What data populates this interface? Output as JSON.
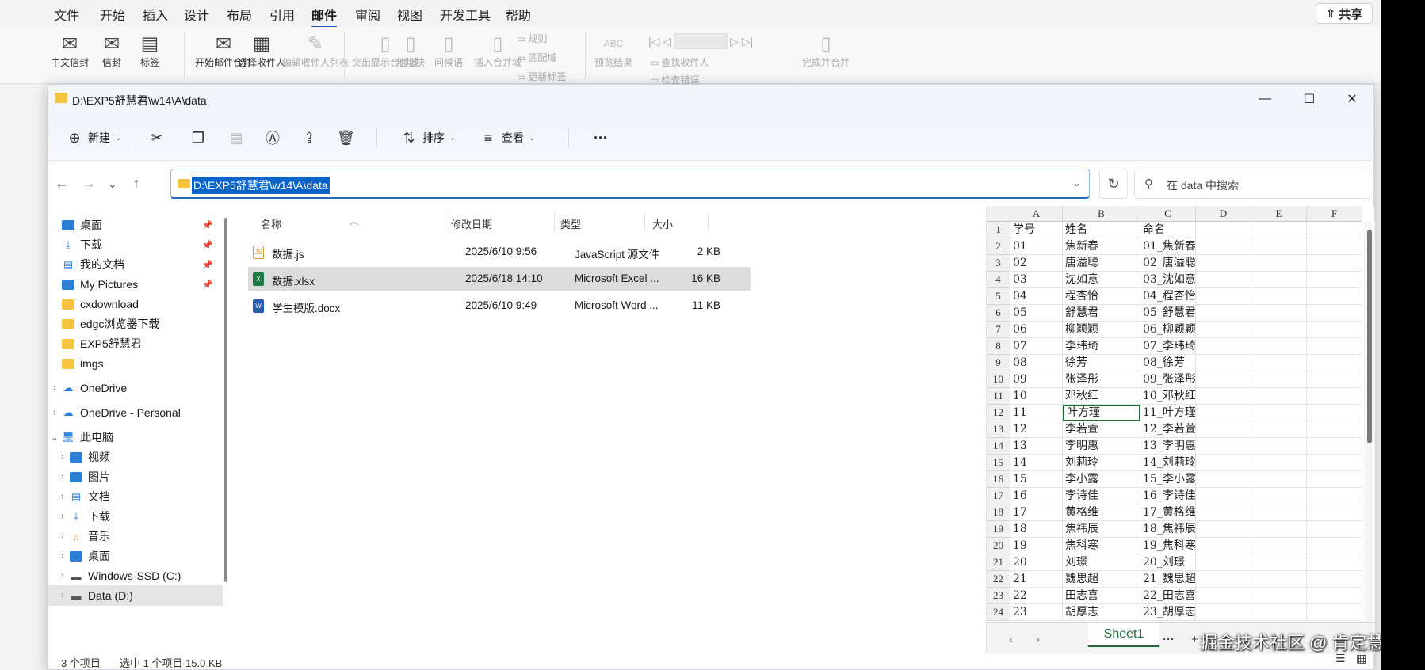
{
  "word": {
    "tabs": [
      "文件",
      "开始",
      "插入",
      "设计",
      "布局",
      "引用",
      "邮件",
      "审阅",
      "视图",
      "开发工具",
      "帮助"
    ],
    "active_tab": "邮件",
    "share_label": "共享",
    "ribbon": {
      "chinese_envelope": "中文信封",
      "envelope": "信封",
      "labels": "标签",
      "start_merge": "开始邮件合并",
      "select_recipients": "选择收件人",
      "edit_recipients": "编辑收件人列表",
      "highlight_fields": "突出显示合并域",
      "address_block": "地址块",
      "greeting_line": "问候语",
      "insert_merge_field": "插入合并域",
      "rules": "规则",
      "match_fields": "匹配域",
      "update_labels": "更新标签",
      "preview_results": "预览结果",
      "find_recipient": "查找收件人",
      "check_errors": "检查错误",
      "finish_merge": "完成并合并"
    }
  },
  "explorer": {
    "title": "D:\\EXP5舒慧君\\w14\\A\\data",
    "commands": {
      "new": "新建",
      "sort": "排序",
      "view": "查看",
      "more": "···"
    },
    "address": "D:\\EXP5舒慧君\\w14\\A\\data",
    "search_placeholder": "在 data 中搜索",
    "sidebar": [
      {
        "label": "桌面",
        "icon": "desktop-icon",
        "pinned": true
      },
      {
        "label": "下载",
        "icon": "download-icon",
        "pinned": true
      },
      {
        "label": "我的文档",
        "icon": "documents-icon",
        "pinned": true
      },
      {
        "label": "My Pictures",
        "icon": "pictures-icon",
        "pinned": true
      },
      {
        "label": "cxdownload",
        "icon": "folder-icon"
      },
      {
        "label": "edgc浏览器下载",
        "icon": "folder-icon"
      },
      {
        "label": "EXP5舒慧君",
        "icon": "folder-icon"
      },
      {
        "label": "imgs",
        "icon": "folder-icon"
      },
      {
        "label": "OneDrive",
        "icon": "cloud-icon"
      },
      {
        "label": "OneDrive - Personal",
        "icon": "cloud-icon"
      },
      {
        "label": "此电脑",
        "icon": "pc-icon"
      },
      {
        "label": "视频",
        "icon": "video-icon"
      },
      {
        "label": "图片",
        "icon": "pictures-icon"
      },
      {
        "label": "文档",
        "icon": "documents-icon"
      },
      {
        "label": "下载",
        "icon": "download-icon"
      },
      {
        "label": "音乐",
        "icon": "music-icon"
      },
      {
        "label": "桌面",
        "icon": "desktop-icon"
      },
      {
        "label": "Windows-SSD (C:)",
        "icon": "drive-icon"
      },
      {
        "label": "Data (D:)",
        "icon": "drive-icon"
      }
    ],
    "columns": [
      "名称",
      "修改日期",
      "类型",
      "大小"
    ],
    "files": [
      {
        "name": "数据.js",
        "date": "2025/6/10 9:56",
        "type": "JavaScript 源文件",
        "size": "2 KB",
        "icon": "js-file-icon"
      },
      {
        "name": "数据.xlsx",
        "date": "2025/6/18 14:10",
        "type": "Microsoft Excel ...",
        "size": "16 KB",
        "icon": "excel-file-icon"
      },
      {
        "name": "学生模版.docx",
        "date": "2025/6/10 9:49",
        "type": "Microsoft Word ...",
        "size": "11 KB",
        "icon": "word-file-icon"
      }
    ],
    "status": {
      "count": "3 个项目",
      "selection": "选中 1 个项目  15.0 KB"
    }
  },
  "excel": {
    "columns": [
      "A",
      "B",
      "C",
      "D",
      "E",
      "F"
    ],
    "rows": [
      [
        "学号",
        "姓名",
        "命名"
      ],
      [
        "01",
        "焦新春",
        "01_焦新春"
      ],
      [
        "02",
        "唐溢聪",
        "02_唐溢聪"
      ],
      [
        "03",
        "沈如意",
        "03_沈如意"
      ],
      [
        "04",
        "程杏怡",
        "04_程杏怡"
      ],
      [
        "05",
        "舒慧君",
        "05_舒慧君"
      ],
      [
        "06",
        "柳颖颖",
        "06_柳颖颖"
      ],
      [
        "07",
        "李玮琦",
        "07_李玮琦"
      ],
      [
        "08",
        "徐芳",
        "08_徐芳"
      ],
      [
        "09",
        "张泽彤",
        "09_张泽彤"
      ],
      [
        "10",
        "邓秋红",
        "10_邓秋红"
      ],
      [
        "11",
        "叶方瑾",
        "11_叶方瑾"
      ],
      [
        "12",
        "李若萱",
        "12_李若萱"
      ],
      [
        "13",
        "李明惠",
        "13_李明惠"
      ],
      [
        "14",
        "刘莉玲",
        "14_刘莉玲"
      ],
      [
        "15",
        "李小露",
        "15_李小露"
      ],
      [
        "16",
        "李诗佳",
        "16_李诗佳"
      ],
      [
        "17",
        "黄格维",
        "17_黄格维"
      ],
      [
        "18",
        "焦祎辰",
        "18_焦祎辰"
      ],
      [
        "19",
        "焦科寒",
        "19_焦科寒"
      ],
      [
        "20",
        "刘璟",
        "20_刘璟"
      ],
      [
        "21",
        "魏思超",
        "21_魏思超"
      ],
      [
        "22",
        "田志喜",
        "22_田志喜"
      ],
      [
        "23",
        "胡厚志",
        "23_胡厚志"
      ]
    ],
    "active_cell": "B12",
    "sheet_tab": "Sheet1",
    "sheet_more": "···",
    "add_sheet": "+"
  },
  "watermark": "掘金技术社区 @ 肯定慧",
  "colors": {
    "accent": "#0a64c8",
    "excel_green": "#1e6b3c",
    "folder": "#f6c443"
  }
}
